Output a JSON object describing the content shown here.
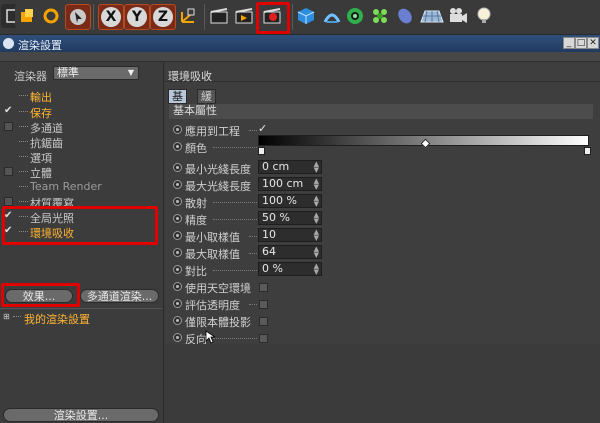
{
  "toolbar": {
    "icons": [
      "window-icon",
      "move-icon",
      "rotate-icon",
      "select-arrow-icon",
      "x-axis-icon",
      "y-axis-icon",
      "z-axis-icon",
      "coordinate-icon",
      "render-view-icon",
      "render-picture-viewer-icon",
      "render-settings-icon",
      "cube-icon",
      "bend-icon",
      "hypernurbs-icon",
      "cloner-icon",
      "environment-icon",
      "floor-icon",
      "camera-icon",
      "light-icon"
    ],
    "axis_x": "X",
    "axis_y": "Y",
    "axis_z": "Z",
    "highlight_color": "#e00000"
  },
  "window": {
    "title": "渲染設置",
    "btn_min": "_",
    "btn_max": "□",
    "btn_close": "✕"
  },
  "left": {
    "renderer_label": "渲染器",
    "renderer_value": "標準",
    "items": [
      {
        "label": "輸出",
        "state": "none"
      },
      {
        "label": "保存",
        "state": "checked"
      },
      {
        "label": "多通道",
        "state": "box"
      },
      {
        "label": "抗鋸齒",
        "state": "none"
      },
      {
        "label": "選項",
        "state": "none"
      },
      {
        "label": "立體",
        "state": "box"
      },
      {
        "label": "Team Render",
        "state": "none"
      },
      {
        "label": "材質覆寫",
        "state": "box"
      },
      {
        "label": "全局光照",
        "state": "checked"
      },
      {
        "label": "環境吸收",
        "state": "checked"
      }
    ],
    "effects_button": "效果...",
    "multipass_button": "多通道渲染...",
    "my_settings": "我的渲染設置",
    "render_settings_button": "渲染設置..."
  },
  "right": {
    "header": "環境吸收",
    "tabs": [
      "基本",
      "緩存"
    ],
    "section": "基本屬性",
    "params": [
      {
        "label": "應用到工程",
        "type": "check",
        "value": "✓"
      },
      {
        "label": "顏色",
        "type": "gradient",
        "value": ""
      },
      {
        "label": "最小光綫長度",
        "type": "field",
        "value": "0 cm"
      },
      {
        "label": "最大光綫長度",
        "type": "field",
        "value": "100 cm"
      },
      {
        "label": "散射",
        "type": "field",
        "value": "100 %"
      },
      {
        "label": "精度",
        "type": "field",
        "value": "50 %"
      },
      {
        "label": "最小取樣值",
        "type": "field",
        "value": "10"
      },
      {
        "label": "最大取樣值",
        "type": "field",
        "value": "64"
      },
      {
        "label": "對比",
        "type": "field",
        "value": "0 %"
      },
      {
        "label": "使用天空環境",
        "type": "box",
        "value": ""
      },
      {
        "label": "評估透明度",
        "type": "box",
        "value": ""
      },
      {
        "label": "僅限本體投影",
        "type": "box",
        "value": ""
      },
      {
        "label": "反向",
        "type": "box",
        "value": ""
      }
    ]
  }
}
